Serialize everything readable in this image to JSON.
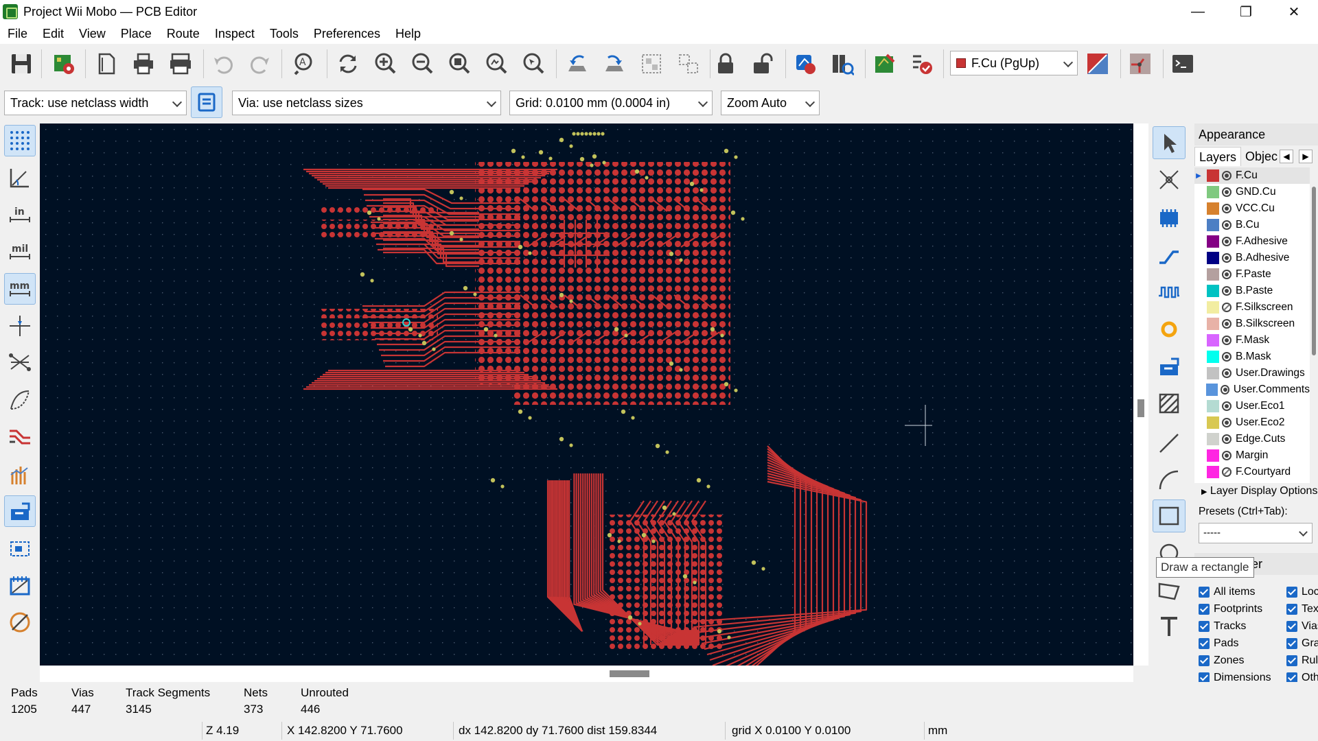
{
  "window": {
    "title": "Project Wii Mobo — PCB Editor",
    "minimize_glyph": "—",
    "maximize_glyph": "❐",
    "close_glyph": "✕"
  },
  "menu": [
    "File",
    "Edit",
    "View",
    "Place",
    "Route",
    "Inspect",
    "Tools",
    "Preferences",
    "Help"
  ],
  "toolbar_icons": [
    "save-icon",
    "board-setup-icon",
    "page-settings-icon",
    "print-icon",
    "plot-icon",
    "undo-icon",
    "redo-icon",
    "find-icon",
    "redraw-icon",
    "zoom-in-icon",
    "zoom-out-icon",
    "zoom-fit-icon",
    "zoom-objects-icon",
    "zoom-selection-icon",
    "rotate-ccw-icon",
    "rotate-cw-icon",
    "group-icon",
    "ungroup-icon",
    "lock-icon",
    "unlock-icon",
    "netlist-icon",
    "footprint-editor-icon",
    "update-pcb-icon",
    "drc-icon",
    "layer-pair-icon",
    "autoroute-icon",
    "scripting-console-icon"
  ],
  "layer_combo": {
    "value": "F.Cu (PgUp)",
    "color": "#c83434"
  },
  "second_toolbar": {
    "track_width": "Track: use netclass width",
    "via_size": "Via: use netclass sizes",
    "grid": "Grid: 0.0100 mm (0.0004 in)",
    "zoom": "Zoom Auto"
  },
  "left_tools": [
    "grid-toggle-icon",
    "polar-coords-icon",
    "inch-units-icon",
    "mil-units-icon",
    "mm-units-icon",
    "full-crosshair-icon",
    "ratsnest-icon",
    "curved-ratsnest-icon",
    "hide-tracks-icon",
    "high-contrast-icon",
    "zone-fill-icon",
    "zone-outline-icon",
    "footprint-outline-icon",
    "draw-mode-icon"
  ],
  "right_tools": [
    "select-icon",
    "local-ratsnest-icon",
    "add-footprint-icon",
    "route-track-icon",
    "tune-length-icon",
    "add-via-icon",
    "add-zone-icon",
    "add-rule-area-icon",
    "draw-line-icon",
    "draw-arc-icon",
    "draw-rectangle-icon",
    "draw-circle-icon",
    "draw-polygon-icon",
    "add-text-icon"
  ],
  "tooltip": "Draw a rectangle",
  "appearance": {
    "title": "Appearance",
    "tabs": [
      "Layers",
      "Objec"
    ],
    "layers": [
      {
        "name": "F.Cu",
        "color": "#c83434",
        "visible": true,
        "selected": true
      },
      {
        "name": "GND.Cu",
        "color": "#7fc97f",
        "visible": true
      },
      {
        "name": "VCC.Cu",
        "color": "#d6812e",
        "visible": true
      },
      {
        "name": "B.Cu",
        "color": "#4d7fc4",
        "visible": true
      },
      {
        "name": "F.Adhesive",
        "color": "#840084",
        "visible": true
      },
      {
        "name": "B.Adhesive",
        "color": "#000084",
        "visible": true
      },
      {
        "name": "F.Paste",
        "color": "#b4a09f",
        "visible": true
      },
      {
        "name": "B.Paste",
        "color": "#00c2c2",
        "visible": true
      },
      {
        "name": "F.Silkscreen",
        "color": "#f2eda1",
        "visible": false
      },
      {
        "name": "B.Silkscreen",
        "color": "#e8b2a7",
        "visible": true
      },
      {
        "name": "F.Mask",
        "color": "#d864ff",
        "visible": true
      },
      {
        "name": "B.Mask",
        "color": "#02ffee",
        "visible": true
      },
      {
        "name": "User.Drawings",
        "color": "#c2c2c2",
        "visible": true
      },
      {
        "name": "User.Comments",
        "color": "#5994dc",
        "visible": true
      },
      {
        "name": "User.Eco1",
        "color": "#b4dbd2",
        "visible": true
      },
      {
        "name": "User.Eco2",
        "color": "#d8c852",
        "visible": true
      },
      {
        "name": "Edge.Cuts",
        "color": "#d0d2cd",
        "visible": true
      },
      {
        "name": "Margin",
        "color": "#ff26e2",
        "visible": true
      },
      {
        "name": "F.Courtyard",
        "color": "#ff26e2",
        "visible": false
      }
    ],
    "layer_display_options": "Layer Display Options",
    "presets_label": "Presets (Ctrl+Tab):",
    "presets_value": "-----"
  },
  "selection_filter": {
    "title": "ilter",
    "left": [
      "All items",
      "Footprints",
      "Tracks",
      "Pads",
      "Zones",
      "Dimensions"
    ],
    "right": [
      "Loc",
      "Text",
      "Vias",
      "Gra",
      "Rul",
      "Oth"
    ]
  },
  "board_stats": {
    "pads_label": "Pads",
    "pads": "1205",
    "vias_label": "Vias",
    "vias": "447",
    "segments_label": "Track Segments",
    "segments": "3145",
    "nets_label": "Nets",
    "nets": "373",
    "unrouted_label": "Unrouted",
    "unrouted": "446"
  },
  "status": {
    "zoom": "Z 4.19",
    "xy": "X 142.8200  Y 71.7600",
    "delta": "dx 142.8200  dy 71.7600  dist 159.8344",
    "grid": "grid X 0.0100  Y 0.0100",
    "units": "mm"
  },
  "colors": {
    "canvas_bg": "#001023",
    "track": "#c83434",
    "pad": "#c83434",
    "via_ring": "#c2c25b"
  }
}
